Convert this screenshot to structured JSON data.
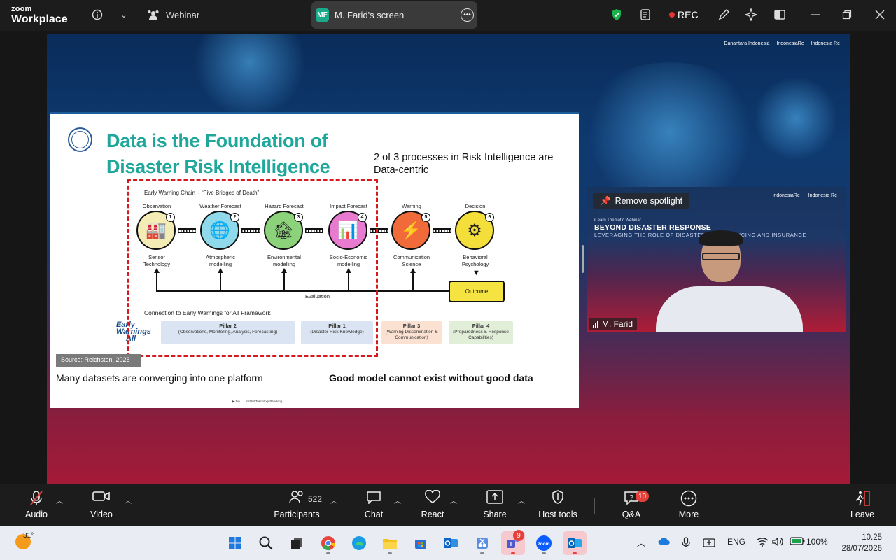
{
  "titlebar": {
    "brand_line1": "zoom",
    "brand_line2": "Workplace",
    "info_icon": "info-icon",
    "webinar_label": "Webinar",
    "screen_initials": "MF",
    "screen_title": "M. Farid's screen",
    "rec_label": "REC",
    "rec_color": "#e33333"
  },
  "slide": {
    "title_line1": "Data is the Foundation of",
    "title_line2": "Disaster Risk Intelligence",
    "process_note": "2 of 3 processes in Risk Intelligence are Data-centric",
    "chain_title": "Early Warning Chain – “Five Bridges of Death”",
    "steps": [
      {
        "head": "Observation",
        "num": "1",
        "sub1": "Sensor",
        "sub2": "Technology",
        "color": "#f3ecb4",
        "glyph": "🏭"
      },
      {
        "head": "Weather Forecast",
        "num": "2",
        "sub1": "Atmospheric",
        "sub2": "modelling",
        "color": "#8fd9ea",
        "glyph": "🌐"
      },
      {
        "head": "Hazard Forecast",
        "num": "3",
        "sub1": "Environmental",
        "sub2": "modelling",
        "color": "#8bd27a",
        "glyph": "🏚"
      },
      {
        "head": "Impact Forecast",
        "num": "4",
        "sub1": "Socio-Economic",
        "sub2": "modelling",
        "color": "#e87ad0",
        "glyph": "📊"
      },
      {
        "head": "Warning",
        "num": "5",
        "sub1": "Communication",
        "sub2": "Science",
        "color": "#f06a3a",
        "glyph": "⚡"
      },
      {
        "head": "Decision",
        "num": "6",
        "sub1": "Behavioral",
        "sub2": "Psychology",
        "color": "#f3de3a",
        "glyph": "⚙"
      }
    ],
    "evaluation": "Evaluation",
    "outcome": "Outcome",
    "connection_label": "Connection to Early Warnings for All Framework",
    "ew_logo_line1": "Early",
    "ew_logo_line2": "Warnings",
    "ew_logo_line3": "All",
    "pillars": [
      {
        "name": "Pillar 2",
        "desc": "(Observations, Monitoring, Analysis, Forecasting)",
        "color": "#dbe4f2"
      },
      {
        "name": "Pillar 1",
        "desc": "(Disaster Risk Knowledge)",
        "color": "#dbe4f2"
      },
      {
        "name": "Pillar 3",
        "desc": "(Warning Dissemination & Communication)",
        "color": "#fbe1d2"
      },
      {
        "name": "Pillar 4",
        "desc": "(Preparedness & Response Capabilities)",
        "color": "#e1eed8"
      }
    ],
    "source": "Source: Reichsten, 2025",
    "bottom_left": "Many datasets are converging into one platform",
    "bottom_right": "Good model cannot exist without good data",
    "footer": "Institut Teknologi Bandung"
  },
  "stage_logos": {
    "logo1": "Danantara Indonesia",
    "logo2": "IndonesiaRe",
    "logo3": "Indonesia Re"
  },
  "tile": {
    "spotlight_label": "Remove spotlight",
    "logo1": "IndonesiaRe",
    "logo2": "Indonesia Re",
    "tag": "iLearn Thematic Webinar",
    "heading": "BEYOND DISASTER RESPONSE",
    "subheading": "LEVERAGING THE ROLE OF DISASTER RISK FINANCING AND INSURANCE",
    "name": "M. Farid"
  },
  "toolbar": {
    "audio": "Audio",
    "video": "Video",
    "participants": "Participants",
    "participant_count": "522",
    "chat": "Chat",
    "react": "React",
    "share": "Share",
    "host_tools": "Host tools",
    "qa": "Q&A",
    "qa_badge": "10",
    "more": "More",
    "leave": "Leave"
  },
  "taskbar": {
    "temperature": "31°",
    "teams_badge": "9",
    "language": "ENG",
    "battery": "100%",
    "time": "10.25",
    "date": "28/07/2026"
  }
}
